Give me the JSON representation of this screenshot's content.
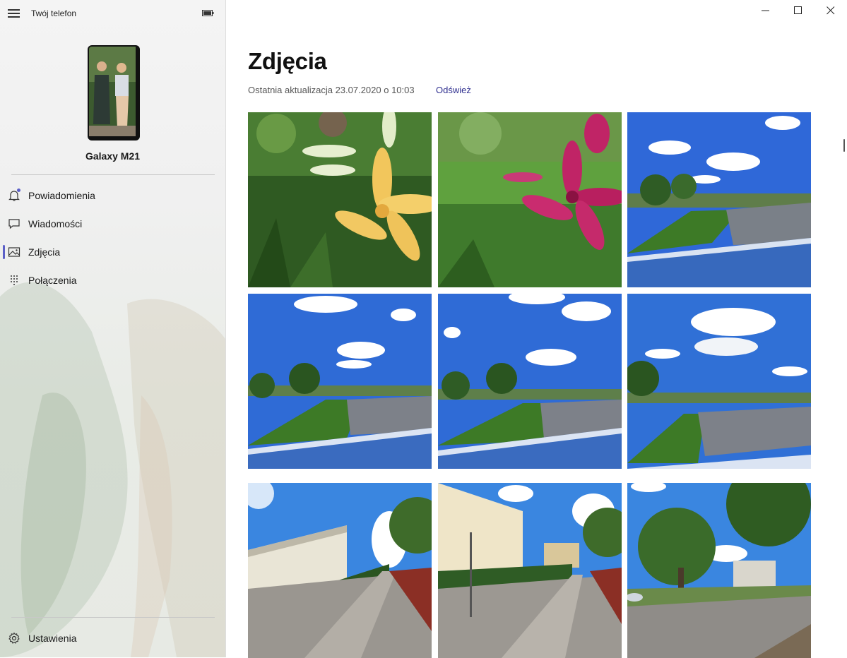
{
  "app": {
    "title": "Twój telefon"
  },
  "device": {
    "name": "Galaxy M21"
  },
  "nav": {
    "items": [
      {
        "label": "Powiadomienia",
        "icon": "bell-icon",
        "active": false,
        "badge": true
      },
      {
        "label": "Wiadomości",
        "icon": "message-icon",
        "active": false,
        "badge": false
      },
      {
        "label": "Zdjęcia",
        "icon": "photos-icon",
        "active": true,
        "badge": false
      },
      {
        "label": "Połączenia",
        "icon": "dialpad-icon",
        "active": false,
        "badge": false
      }
    ],
    "settings_label": "Ustawienia"
  },
  "main": {
    "title": "Zdjęcia",
    "last_update": "Ostatnia aktualizacja 23.07.2020 o 10:03",
    "refresh_label": "Odśwież"
  },
  "photos": [
    {
      "subject": "yellow-lily"
    },
    {
      "subject": "pink-lily"
    },
    {
      "subject": "river-panorama"
    },
    {
      "subject": "river-panorama"
    },
    {
      "subject": "river-panorama"
    },
    {
      "subject": "river-panorama"
    },
    {
      "subject": "street-building"
    },
    {
      "subject": "street-building"
    },
    {
      "subject": "street-tree"
    }
  ],
  "colors": {
    "accent": "#5b5fc7",
    "link": "#2f2f8f"
  }
}
